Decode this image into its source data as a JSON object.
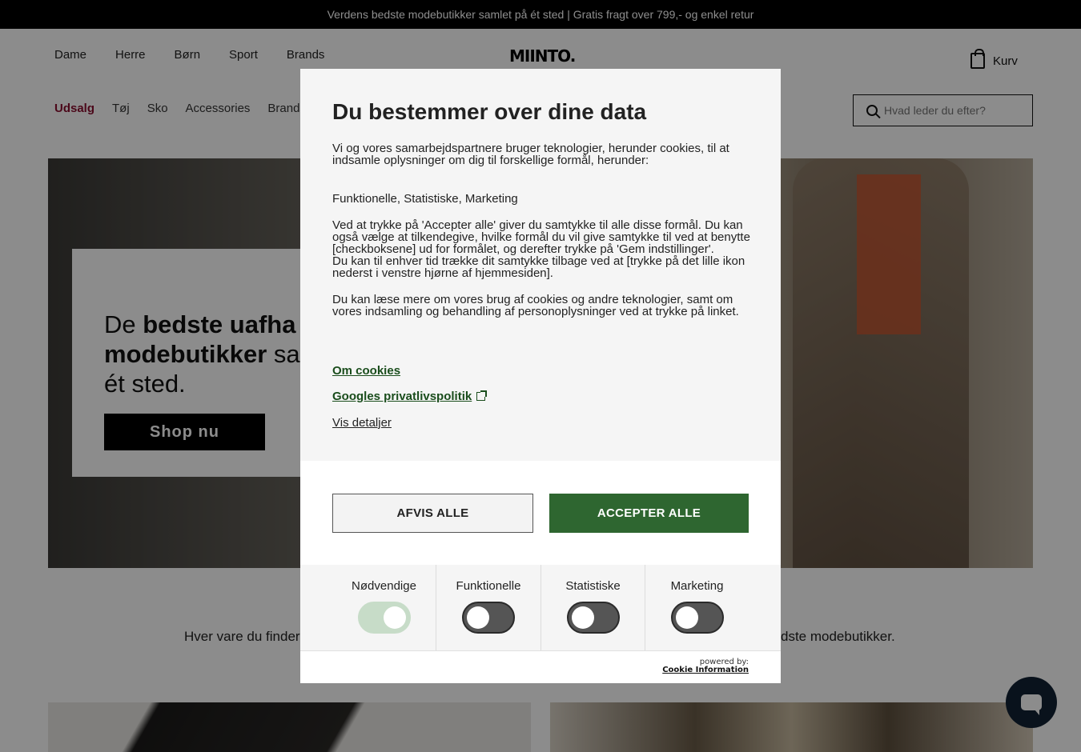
{
  "announcement": "Verdens bedste modebutikker samlet på ét sted | Gratis fragt over 799,- og enkel retur",
  "header": {
    "nav": [
      "Dame",
      "Herre",
      "Børn",
      "Sport",
      "Brands"
    ],
    "logo": "MIINTO.",
    "cart_label": "Kurv",
    "subnav": [
      "Udsalg",
      "Tøj",
      "Sko",
      "Accessories",
      "Brands"
    ],
    "search_placeholder": "Hvad leder du efter?"
  },
  "hero": {
    "title_part1": "De ",
    "title_bold1": "bedste uafha",
    "title_bold2": "modebutikker",
    "title_part2": " sa",
    "title_line3": "ét sted.",
    "cta": "Shop nu"
  },
  "tagline_left": "Hver vare du finder",
  "tagline_right": "dste modebutikker.",
  "modal": {
    "title": "Du bestemmer over dine data",
    "intro": "Vi og vores samarbejdspartnere bruger teknologier, herunder cookies, til at indsamle oplysninger om dig til forskellige formål, herunder:",
    "purposes": "Funktionelle, Statistiske, Marketing",
    "consent_text": "Ved at trykke på 'Accepter alle' giver du samtykke til alle disse formål. Du kan også vælge at tilkendegive, hvilke formål du vil give samtykke til ved at benytte [checkboksene] ud for formålet, og derefter trykke på 'Gem indstillinger'.",
    "withdraw_text": "Du kan til enhver tid trække dit samtykke tilbage ved at [trykke på det lille ikon nederst i venstre hjørne af hjemmesiden].",
    "more_text": "Du kan læse mere om vores brug af cookies og andre teknologier, samt om vores indsamling og behandling af personoplysninger ved at trykke på linket.",
    "link_cookies": "Om cookies",
    "link_google": "Googles privatlivspolitik",
    "link_details": "Vis detaljer",
    "reject_label": "AFVIS ALLE",
    "accept_label": "ACCEPTER ALLE",
    "categories": [
      {
        "label": "Nødvendige",
        "enabled": true
      },
      {
        "label": "Funktionelle",
        "enabled": false
      },
      {
        "label": "Statistiske",
        "enabled": false
      },
      {
        "label": "Marketing",
        "enabled": false
      }
    ],
    "powered_by": "powered by:",
    "provider": "Cookie Information"
  },
  "colors": {
    "accept_green": "#2e6630",
    "sale_red": "#8a1030",
    "announcement_bg": "#000000"
  }
}
